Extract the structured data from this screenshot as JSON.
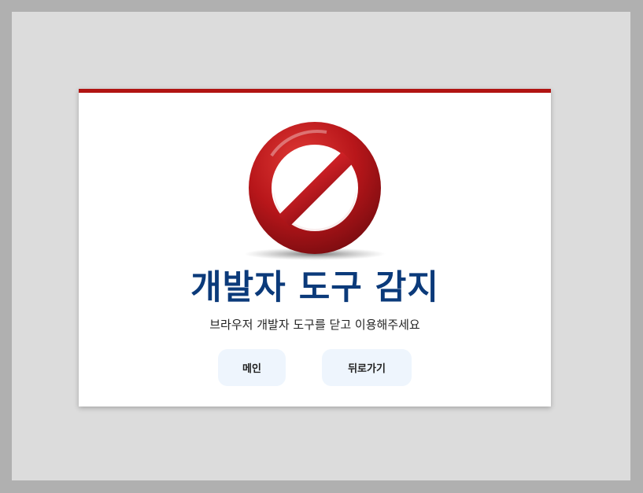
{
  "dialog": {
    "icon": "prohibited-icon",
    "title": "개발자 도구 감지",
    "message": "브라우저 개발자 도구를 닫고 이용해주세요",
    "buttons": {
      "main_label": "메인",
      "back_label": "뒤로가기"
    }
  },
  "colors": {
    "accent_bar": "#b11412",
    "title": "#0b3a7a",
    "button_bg": "#eef5fd",
    "page_bg": "#dcdcdc"
  }
}
